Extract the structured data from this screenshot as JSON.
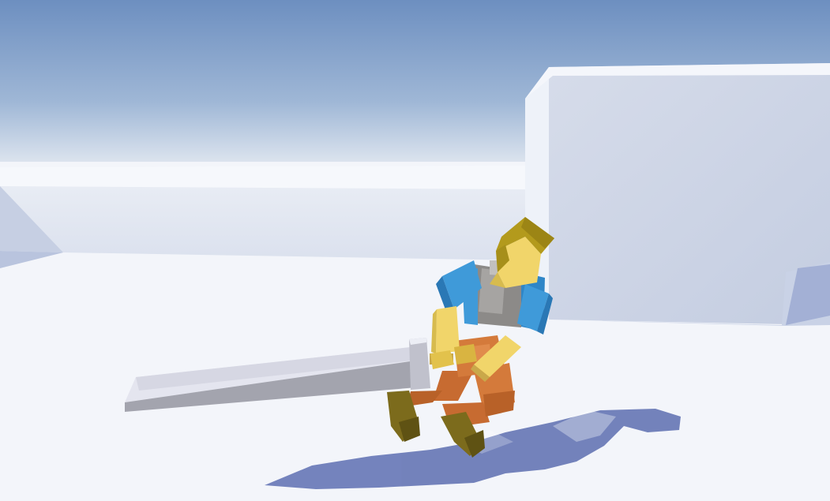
{
  "scene": {
    "type": "3d-game-viewport",
    "colors": {
      "sky_top": "#6d8fc0",
      "sky_horizon": "#d2dde8",
      "ground": "#f3f5fa",
      "shadow": "#5d6fb1",
      "cube_front": "#c9d1e3",
      "cube_side": "#e7ecf5",
      "cube_top": "#f2f5fb",
      "sword_blade": "#d7d8e6",
      "sword_edge": "#9fa0aa",
      "character_head": "#f1d56a",
      "character_hair": "#b39a1c",
      "character_shirt": "#3f9ad9",
      "character_vest": "#8c8a88",
      "character_pants": "#d47a3b",
      "character_boots": "#7c6b1c"
    }
  }
}
